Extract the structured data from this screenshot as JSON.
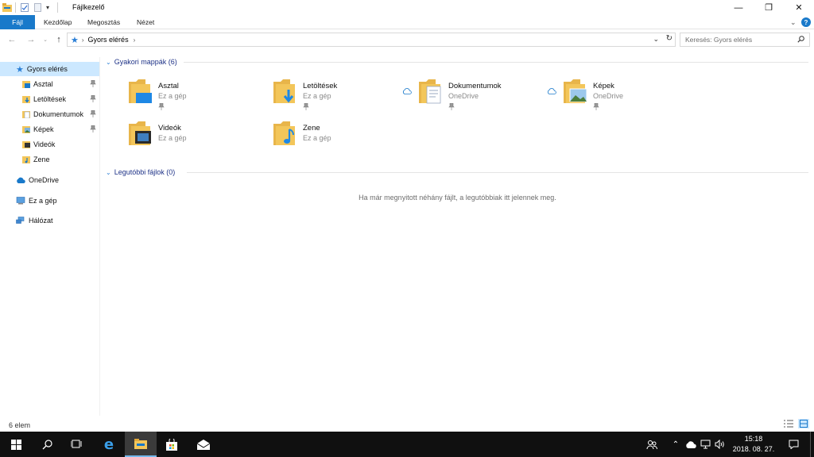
{
  "window": {
    "title": "Fájlkezelő",
    "controls": {
      "minimize": "—",
      "maximize": "❐",
      "close": "✕"
    }
  },
  "ribbon": {
    "tabs": [
      "Fájl",
      "Kezdőlap",
      "Megosztás",
      "Nézet"
    ],
    "help": "?"
  },
  "address": {
    "path": "Gyors elérés",
    "search_placeholder": "Keresés: Gyors elérés"
  },
  "sidebar": {
    "quick_access": "Gyors elérés",
    "items": [
      {
        "label": "Asztal",
        "pinned": true
      },
      {
        "label": "Letöltések",
        "pinned": true
      },
      {
        "label": "Dokumentumok",
        "pinned": true
      },
      {
        "label": "Képek",
        "pinned": true
      },
      {
        "label": "Videók",
        "pinned": false
      },
      {
        "label": "Zene",
        "pinned": false
      }
    ],
    "onedrive": "OneDrive",
    "this_pc": "Ez a gép",
    "network": "Hálózat"
  },
  "content": {
    "frequent_header": "Gyakori mappák (6)",
    "folders": [
      {
        "name": "Asztal",
        "location": "Ez a gép",
        "pinned": true,
        "cloud": false
      },
      {
        "name": "Letöltések",
        "location": "Ez a gép",
        "pinned": true,
        "cloud": false
      },
      {
        "name": "Dokumentumok",
        "location": "OneDrive",
        "pinned": true,
        "cloud": true
      },
      {
        "name": "Képek",
        "location": "OneDrive",
        "pinned": true,
        "cloud": true
      },
      {
        "name": "Videók",
        "location": "Ez a gép",
        "pinned": false,
        "cloud": false
      },
      {
        "name": "Zene",
        "location": "Ez a gép",
        "pinned": false,
        "cloud": false
      }
    ],
    "recent_header": "Legutóbbi fájlok (0)",
    "empty_message": "Ha már megnyitott néhány fájlt, a legutóbbiak itt jelennek meg."
  },
  "status": {
    "count": "6 elem"
  },
  "taskbar": {
    "time": "15:18",
    "date": "2018. 08. 27."
  },
  "colors": {
    "accent": "#1979ca",
    "selection": "#cce8ff",
    "group_header": "#1e3287",
    "folder": "#f3c65a",
    "taskbar": "#101010"
  }
}
